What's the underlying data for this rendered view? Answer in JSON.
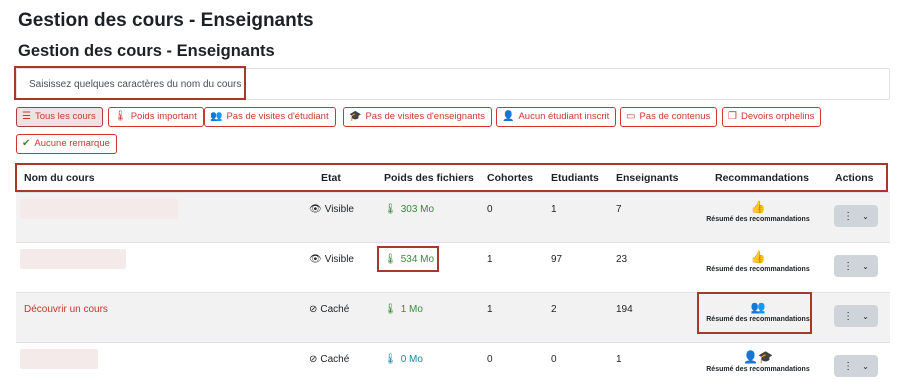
{
  "page": {
    "title": "Gestion des cours - Enseignants",
    "subtitle": "Gestion des cours - Enseignants"
  },
  "search": {
    "placeholder": "Saisissez quelques caractères du nom du cours"
  },
  "filters": [
    {
      "label": "Tous les cours",
      "icon": "list-icon"
    },
    {
      "label": "Poids important",
      "icon": "thermometer-icon"
    },
    {
      "label": "Pas de visites d'étudiant",
      "icon": "users-icon"
    },
    {
      "label": "Pas de visites d'enseignants",
      "icon": "graduation-cap-icon"
    },
    {
      "label": "Aucun étudiant inscrit",
      "icon": "user-icon"
    },
    {
      "label": "Pas de contenus",
      "icon": "empty-box-icon"
    },
    {
      "label": "Devoirs orphelins",
      "icon": "copy-icon"
    },
    {
      "label": "Aucune remarque",
      "icon": "check-circle-icon"
    }
  ],
  "table": {
    "headers": [
      "Nom du cours",
      "Etat",
      "Poids des fichiers",
      "Cohortes",
      "Etudiants",
      "Enseignants",
      "Recommandations",
      "Actions"
    ],
    "rows": [
      {
        "name": "",
        "state": "Visible",
        "state_icon": "eye-icon",
        "weight": "303 Mo",
        "weight_color": "#3a8a3a",
        "cohorts": "0",
        "students": "1",
        "teachers": "7",
        "reco_icon": "thumbs-up-icon",
        "reco_label": "Résumé des recommandations"
      },
      {
        "name": "",
        "state": "Visible",
        "state_icon": "eye-icon",
        "weight": "534 Mo",
        "weight_color": "#3a8a3a",
        "cohorts": "1",
        "students": "97",
        "teachers": "23",
        "reco_icon": "thumbs-up-icon",
        "reco_label": "Résumé des recommandations"
      },
      {
        "name": "Découvrir un cours",
        "state": "Caché",
        "state_icon": "eye-slash-icon",
        "weight": "1 Mo",
        "weight_color": "#3a8a3a",
        "cohorts": "1",
        "students": "2",
        "teachers": "194",
        "reco_icon": "users-icon",
        "reco_label": "Résumé des recommandations"
      },
      {
        "name": "",
        "state": "Caché",
        "state_icon": "eye-slash-icon",
        "weight": "0 Mo",
        "weight_color": "#1a88a8",
        "cohorts": "0",
        "students": "0",
        "teachers": "1",
        "reco_icon": "user-graduation-cap-icon",
        "reco_label": "Résumé des recommandations"
      }
    ]
  },
  "colors": {
    "accent": "#c63a34",
    "highlight_box": "#a33a2a",
    "success": "#3a8a3a",
    "thumbs_up": "#2f7a2a",
    "users_icon": "#1a88a8"
  }
}
